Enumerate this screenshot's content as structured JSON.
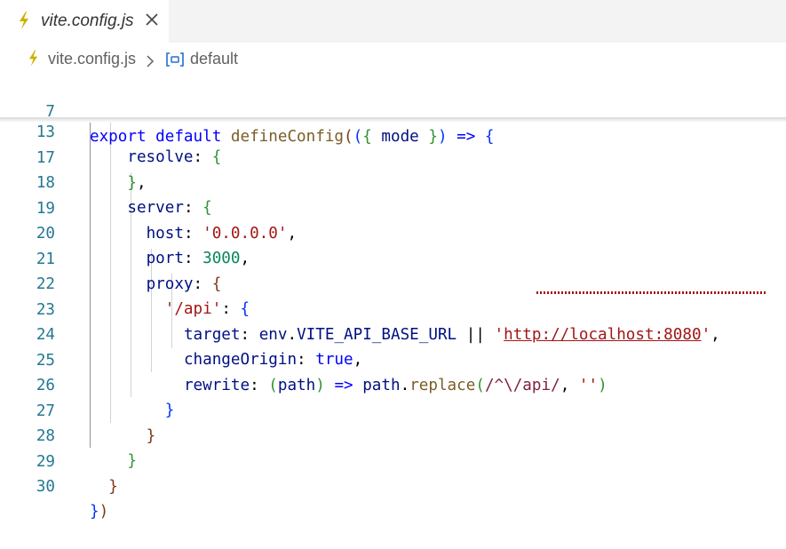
{
  "tab": {
    "title": "vite.config.js",
    "icon": "vite-bolt-icon",
    "close_icon": "close-icon"
  },
  "breadcrumb": {
    "file": "vite.config.js",
    "separator_icon": "chevron-right-icon",
    "symbol_icon": "symbol-variable-icon",
    "symbol": "default"
  },
  "colors": {
    "keyword": "#0000ff",
    "function": "#795e26",
    "property": "#001080",
    "string": "#a31515",
    "number": "#098658",
    "line_number": "#237893",
    "bolt": "#c8b400"
  },
  "editor": {
    "sticky_lines": [
      {
        "number": "7",
        "text": "export default defineConfig(({ mode }) => {"
      },
      {
        "number": "13",
        "text": "resolve: {"
      }
    ],
    "lines": [
      {
        "number": "17",
        "text": "},"
      },
      {
        "number": "18",
        "text": "server: {"
      },
      {
        "number": "19",
        "text": "host: '0.0.0.0',"
      },
      {
        "number": "20",
        "text": "port: 3000,"
      },
      {
        "number": "21",
        "text": "proxy: {"
      },
      {
        "number": "22",
        "text": "'/api': {"
      },
      {
        "number": "23",
        "text": "target: env.VITE_API_BASE_URL || 'http://localhost:8080',"
      },
      {
        "number": "24",
        "text": "changeOrigin: true,"
      },
      {
        "number": "25",
        "text": "rewrite: (path) => path.replace(/^\\/api/, '')"
      },
      {
        "number": "26",
        "text": "}"
      },
      {
        "number": "27",
        "text": "}"
      },
      {
        "number": "28",
        "text": "}"
      },
      {
        "number": "29",
        "text": "}"
      },
      {
        "number": "30",
        "text": "})"
      }
    ]
  }
}
